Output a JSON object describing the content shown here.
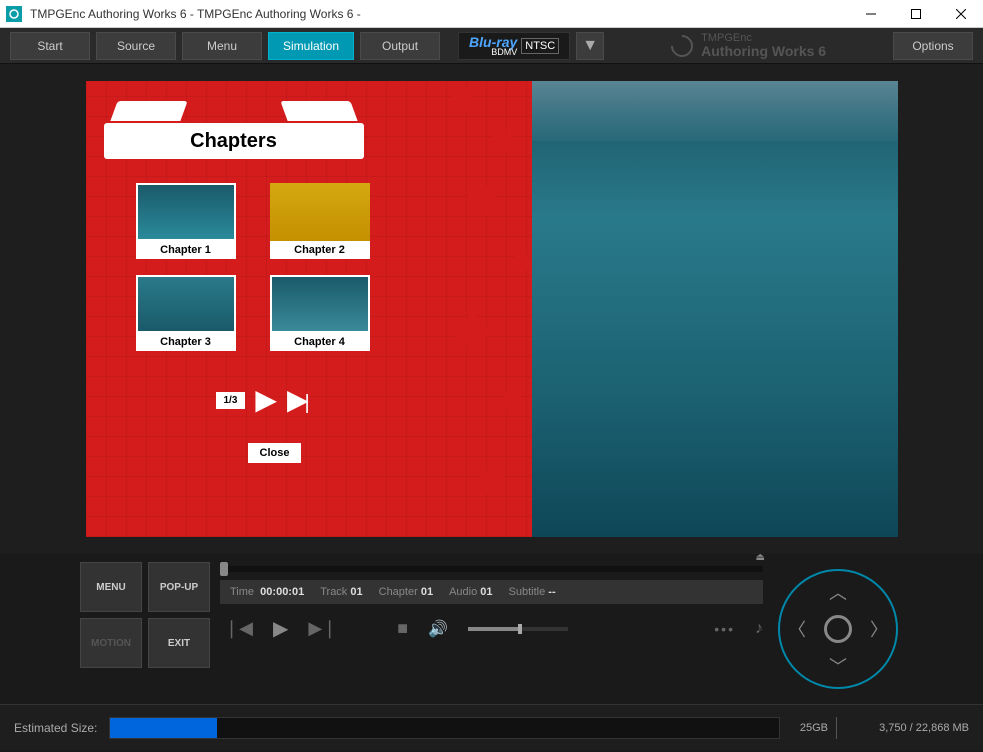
{
  "window": {
    "title": "TMPGEnc Authoring Works 6 - TMPGEnc Authoring Works 6 -"
  },
  "toolbar": {
    "tabs": [
      "Start",
      "Source",
      "Menu",
      "Simulation",
      "Output"
    ],
    "active_tab": "Simulation",
    "disc_type": "Blu-ray",
    "disc_sub": "BDMV",
    "disc_standard": "NTSC",
    "brand_top": "TMPGEnc",
    "brand_bottom": "Authoring Works 6",
    "options": "Options"
  },
  "menu_overlay": {
    "title": "Chapters",
    "chapters": [
      {
        "label": "Chapter 1"
      },
      {
        "label": "Chapter 2"
      },
      {
        "label": "Chapter 3"
      },
      {
        "label": "Chapter 4"
      }
    ],
    "page_indicator": "1/3",
    "close": "Close"
  },
  "controls": {
    "menu": "MENU",
    "popup": "POP-UP",
    "motion": "MOTION",
    "exit": "EXIT",
    "info": {
      "time_label": "Time",
      "time": "00:00:01",
      "track_label": "Track",
      "track": "01",
      "chapter_label": "Chapter",
      "chapter": "01",
      "audio_label": "Audio",
      "audio": "01",
      "subtitle_label": "Subtitle",
      "subtitle": "--"
    }
  },
  "status": {
    "label": "Estimated Size:",
    "capacity": "25GB",
    "size_text": "3,750 / 22,868 MB"
  }
}
